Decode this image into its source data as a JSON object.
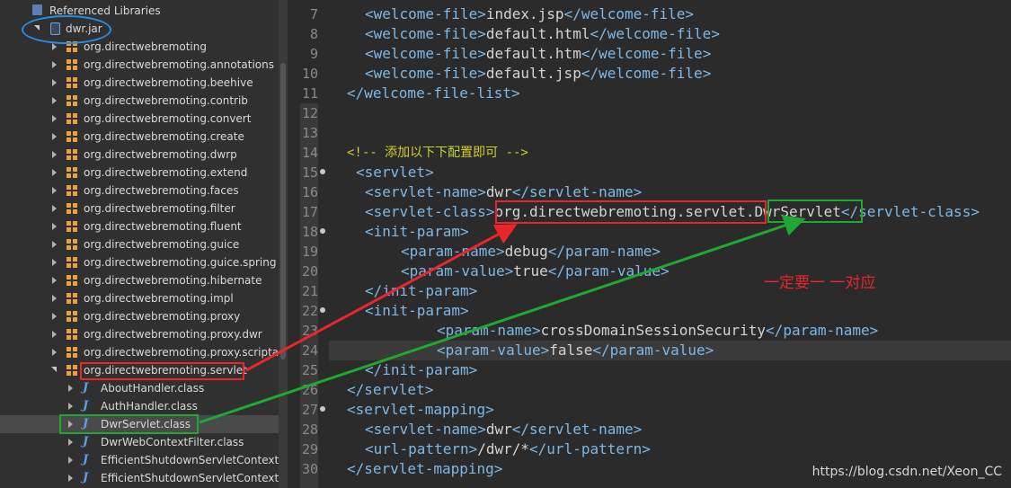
{
  "tree": {
    "referenced_libraries": "Referenced Libraries",
    "jar": "dwr.jar",
    "packages": [
      "org.directwebremoting",
      "org.directwebremoting.annotations",
      "org.directwebremoting.beehive",
      "org.directwebremoting.contrib",
      "org.directwebremoting.convert",
      "org.directwebremoting.create",
      "org.directwebremoting.dwrp",
      "org.directwebremoting.extend",
      "org.directwebremoting.faces",
      "org.directwebremoting.filter",
      "org.directwebremoting.fluent",
      "org.directwebremoting.guice",
      "org.directwebremoting.guice.spring",
      "org.directwebremoting.hibernate",
      "org.directwebremoting.impl",
      "org.directwebremoting.proxy",
      "org.directwebremoting.proxy.dwr",
      "org.directwebremoting.proxy.scripta",
      "org.directwebremoting.servlet"
    ],
    "classes": [
      "AboutHandler.class",
      "AuthHandler.class",
      "DwrServlet.class",
      "DwrWebContextFilter.class",
      "EfficientShutdownServletContextAt",
      "EfficientShutdownServletContextLi"
    ]
  },
  "editor": {
    "line_numbers": [
      "7",
      "8",
      "9",
      "10",
      "11",
      "12",
      "13",
      "14",
      "15",
      "16",
      "17",
      "18",
      "19",
      "20",
      "21",
      "22",
      "23",
      "24",
      "25",
      "26",
      "27",
      "28",
      "29",
      "30"
    ],
    "lines": {
      "l7_open": "<welcome-file>",
      "l7_val": "index.jsp",
      "l7_close": "</welcome-file>",
      "l8_open": "<welcome-file>",
      "l8_val": "default.html",
      "l8_close": "</welcome-file>",
      "l9_open": "<welcome-file>",
      "l9_val": "default.htm",
      "l9_close": "</welcome-file>",
      "l10_open": "<welcome-file>",
      "l10_val": "default.jsp",
      "l10_close": "</welcome-file>",
      "l11": "</welcome-file-list>",
      "l14": "<!-- 添加以下下配置即可 -->",
      "l15": "<servlet>",
      "l16_open": "<servlet-name>",
      "l16_val": "dwr",
      "l16_close": "</servlet-name>",
      "l17_open": "<servlet-class>",
      "l17_pkg": "org.directwebremoting.servlet",
      "l17_dot": ".",
      "l17_cls": "DwrServlet",
      "l17_close": "</servlet-class>",
      "l18": "<init-param>",
      "l19_open": "<param-name>",
      "l19_val": "debug",
      "l19_close": "</param-name>",
      "l20_open": "<param-value>",
      "l20_val": "true",
      "l20_close": "</param-value>",
      "l21": "</init-param>",
      "l22": "<init-param>",
      "l23_open": "<param-name>",
      "l23_val": "crossDomainSessionSecurity",
      "l23_close": "</param-name>",
      "l24_open": "<param-value>",
      "l24_val": "false",
      "l24_close": "</param-value>",
      "l25": "</init-param>",
      "l26": "</servlet>",
      "l27": "<servlet-mapping>",
      "l28_open": "<servlet-name>",
      "l28_val": "dwr",
      "l28_close": "</servlet-name>",
      "l29_open": "<url-pattern>",
      "l29_val": "/dwr/*",
      "l29_close": "</url-pattern>",
      "l30": "</servlet-mapping>"
    }
  },
  "annotation": {
    "note": "一定要一 一对应"
  },
  "watermark": "https://blog.csdn.net/Xeon_CC",
  "colors": {
    "red_box": "#e8262c",
    "green_box": "#21a832",
    "blue_ellipse": "#2b8de0",
    "tag": "#7fb8e6",
    "comment": "#cfcf30"
  }
}
